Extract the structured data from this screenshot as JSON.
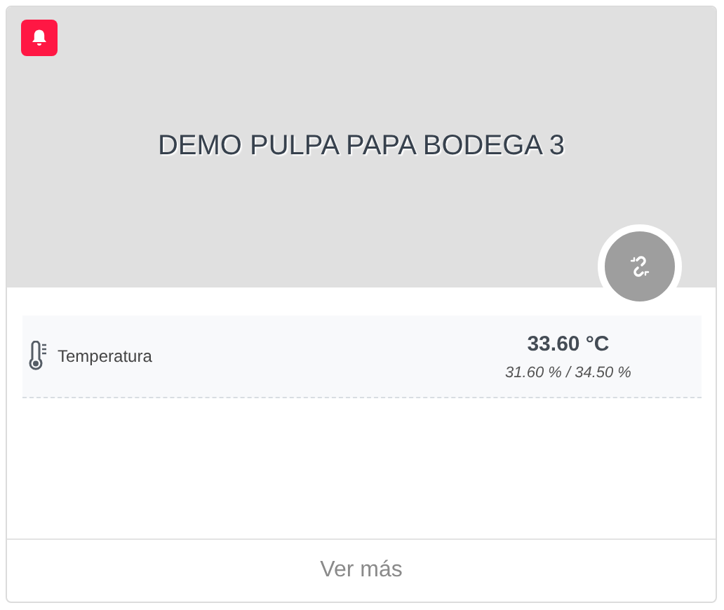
{
  "card": {
    "title": "DEMO PULPA PAPA BODEGA 3",
    "alert": true,
    "connected": false
  },
  "sensors": [
    {
      "kind": "temperature",
      "label": "Temperatura",
      "value": "33.60 °C",
      "range": "31.60 % / 34.50 %"
    }
  ],
  "footer": {
    "link": "Ver más"
  }
}
